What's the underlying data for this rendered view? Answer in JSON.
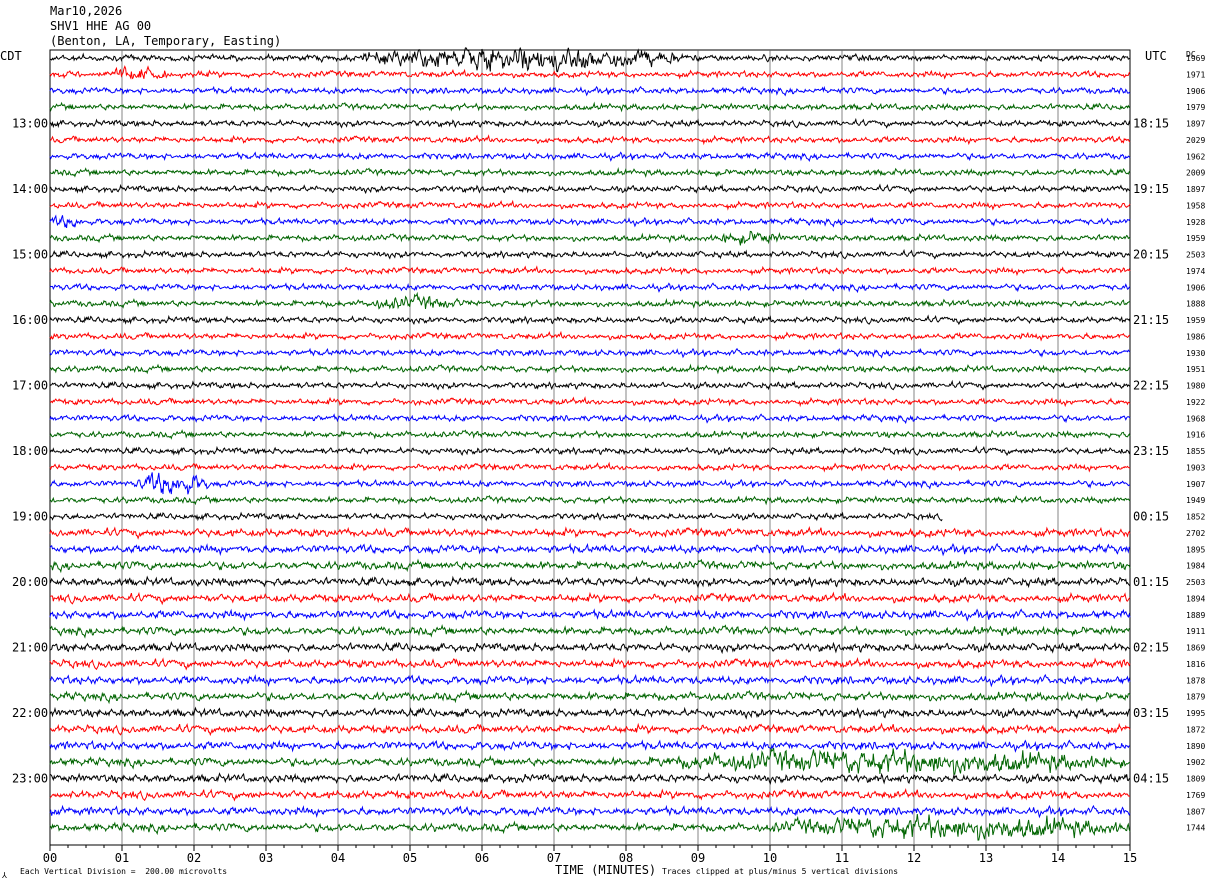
{
  "header": {
    "date": "Mar10,2026",
    "station": "SHV1 HHE AG 00",
    "location": "(Benton, LA, Temporary, Easting)"
  },
  "axes": {
    "left_tz": "CDT",
    "right_tz": "UTC",
    "dc_label": "DC",
    "xlabel": "TIME (MINUTES)",
    "footer_left": "Each Vertical Division =  200.00 microvolts",
    "footer_right": "Traces clipped at plus/minus 5 vertical divisions",
    "corner_mark": "⅄"
  },
  "chart_data": {
    "type": "line",
    "title": "SHV1 HHE AG 00",
    "xlabel": "TIME (MINUTES)",
    "ylabel": "",
    "xlim": [
      0,
      15
    ],
    "x_ticks": [
      "00",
      "01",
      "02",
      "03",
      "04",
      "05",
      "06",
      "07",
      "08",
      "09",
      "10",
      "11",
      "12",
      "13",
      "14",
      "15"
    ],
    "trace_colors": [
      "#000000",
      "#ff0000",
      "#0000ff",
      "#006400"
    ],
    "rows_per_hour": 4,
    "cdt_hour_labels": [
      "13:00",
      "14:00",
      "15:00",
      "16:00",
      "17:00",
      "18:00",
      "19:00",
      "20:00",
      "21:00",
      "22:00",
      "23:00"
    ],
    "utc_hour_labels": [
      "18:15",
      "19:15",
      "20:15",
      "21:15",
      "22:15",
      "23:15",
      "00:15",
      "01:15",
      "02:15",
      "03:15",
      "04:15"
    ],
    "dc_offsets": [
      "1969",
      "1971",
      "1906",
      "1979",
      "1897",
      "2029",
      "1962",
      "2009",
      "1897",
      "1958",
      "1928",
      "1959",
      "2503",
      "1974",
      "1906",
      "1888",
      "1959",
      "1986",
      "1930",
      "1951",
      "1980",
      "1922",
      "1968",
      "1916",
      "1855",
      "1903",
      "1907",
      "1949",
      "1852",
      "2702",
      "1895",
      "1984",
      "2503",
      "1894",
      "1889",
      "1911",
      "1869",
      "1816",
      "1878",
      "1879",
      "1995",
      "1872",
      "1890",
      "1902",
      "1809",
      "1769",
      "1807",
      "1744"
    ],
    "events": [
      {
        "row": 0,
        "start_min": 4.3,
        "end_min": 8.8,
        "level": "high"
      },
      {
        "row": 1,
        "start_min": 0.7,
        "end_min": 1.7,
        "level": "medium"
      },
      {
        "row": 10,
        "start_min": 0.0,
        "end_min": 0.5,
        "level": "medium"
      },
      {
        "row": 11,
        "start_min": 9.2,
        "end_min": 10.2,
        "level": "medium"
      },
      {
        "row": 15,
        "start_min": 4.3,
        "end_min": 5.8,
        "level": "medium"
      },
      {
        "row": 26,
        "start_min": 1.2,
        "end_min": 2.2,
        "level": "high"
      },
      {
        "row": 43,
        "start_min": 8.3,
        "end_min": 15.0,
        "level": "high"
      },
      {
        "row": 47,
        "start_min": 10.0,
        "end_min": 15.0,
        "level": "high"
      }
    ]
  }
}
